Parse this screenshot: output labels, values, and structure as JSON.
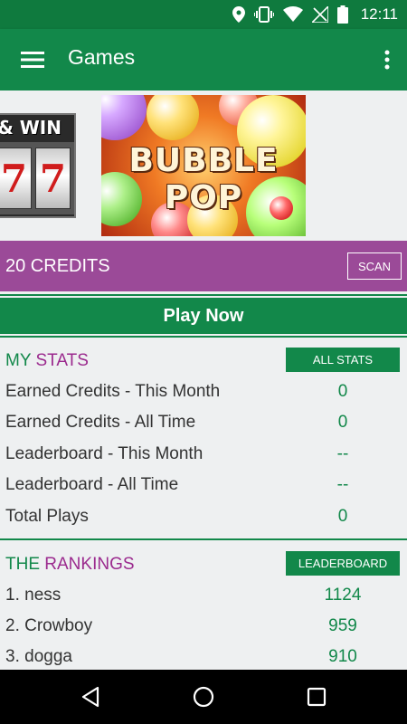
{
  "status_bar": {
    "time": "12:11",
    "icons": [
      "location-icon",
      "vibrate-icon",
      "wifi-icon",
      "no-signal-icon",
      "battery-icon"
    ]
  },
  "app_bar": {
    "title": "Games",
    "menu_icon": "hamburger-menu-icon",
    "overflow_icon": "more-vert-icon"
  },
  "banner": {
    "tiles": [
      {
        "name": "slots",
        "text": "& WIN",
        "reels": [
          "7",
          "7"
        ]
      },
      {
        "name": "bubble-pop",
        "text": "BUBBLE POP"
      }
    ]
  },
  "credits": {
    "label": "20 CREDITS",
    "scan_label": "SCAN"
  },
  "play_now_label": "Play Now",
  "my_stats": {
    "heading_part1": "MY",
    "heading_part2": "STATS",
    "all_stats_label": "ALL STATS",
    "rows": [
      {
        "label": "Earned Credits - This Month",
        "value": "0"
      },
      {
        "label": "Earned Credits - All Time",
        "value": "0"
      },
      {
        "label": "Leaderboard - This Month",
        "value": "--"
      },
      {
        "label": "Leaderboard - All Time",
        "value": "--"
      },
      {
        "label": "Total Plays",
        "value": "0"
      }
    ]
  },
  "rankings": {
    "heading_part1": "THE",
    "heading_part2": "RANKINGS",
    "leaderboard_label": "LEADERBOARD",
    "rows": [
      {
        "label": "1. ness",
        "value": "1124"
      },
      {
        "label": "2. Crowboy",
        "value": "959"
      },
      {
        "label": "3. dogga",
        "value": "910"
      }
    ]
  },
  "colors": {
    "primary_green": "#12884a",
    "status_green": "#0f7a3e",
    "credits_purple": "#9b4a98",
    "heading_purple": "#9b2a8e"
  },
  "nav_bar": {
    "icons": [
      "back-icon",
      "home-icon",
      "recents-icon"
    ]
  }
}
